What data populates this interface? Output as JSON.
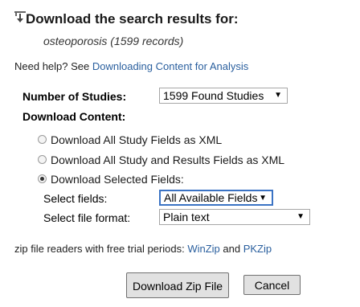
{
  "header": {
    "title": "Download the search results for:",
    "query": "osteoporosis",
    "record_count": "(1599 records)",
    "icon": "download-icon"
  },
  "help": {
    "prefix": "Need help? See ",
    "link": "Downloading Content for Analysis"
  },
  "studies": {
    "label": "Number of Studies:",
    "selected": "1599 Found Studies"
  },
  "content": {
    "label": "Download Content:",
    "options": [
      {
        "label": "Download All Study Fields as XML",
        "checked": false
      },
      {
        "label": "Download All Study and Results Fields as XML",
        "checked": false
      },
      {
        "label": "Download Selected Fields:",
        "checked": true
      }
    ]
  },
  "fields": {
    "label": "Select fields:",
    "selected": "All Available Fields"
  },
  "format": {
    "label": "Select file format:",
    "selected": "Plain text"
  },
  "zip": {
    "prefix": "zip file readers with free trial periods: ",
    "link1": "WinZip",
    "and": " and ",
    "link2": "PKZip"
  },
  "buttons": {
    "download": "Download Zip File",
    "cancel": "Cancel"
  },
  "colors": {
    "link": "#2a5f9e",
    "focus_border": "#3b73c4"
  }
}
